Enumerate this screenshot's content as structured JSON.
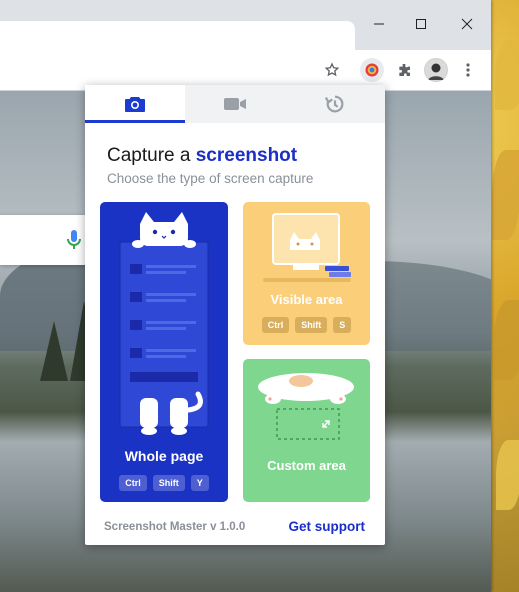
{
  "window": {
    "minimize_icon": "minimize-icon",
    "maximize_icon": "maximize-icon",
    "close_icon": "close-icon"
  },
  "toolbar": {
    "bookmark_icon": "star-icon",
    "extension_icon": "screenshot-master-icon",
    "extensions_icon": "puzzle-icon",
    "profile_icon": "avatar",
    "menu_icon": "kebab-menu-icon"
  },
  "popup": {
    "tabs": [
      {
        "name": "screenshot",
        "icon": "camera-icon",
        "active": true
      },
      {
        "name": "video",
        "icon": "video-camera-icon",
        "active": false
      },
      {
        "name": "history",
        "icon": "history-icon",
        "active": false
      }
    ],
    "heading_prefix": "Capture a",
    "heading_accent": "screenshot",
    "subheading": "Choose the type of screen capture",
    "options": {
      "whole_page": {
        "label": "Whole page",
        "keys": [
          "Ctrl",
          "Shift",
          "Y"
        ],
        "color": "#1b33c4"
      },
      "visible_area": {
        "label": "Visible area",
        "keys": [
          "Ctrl",
          "Shift",
          "S"
        ],
        "color": "#fbcf7a"
      },
      "custom_area": {
        "label": "Custom area",
        "color": "#7fd68e"
      }
    },
    "version": "Screenshot Master v 1.0.0",
    "support_link": "Get support",
    "accent_color": "#1b2fc7"
  }
}
